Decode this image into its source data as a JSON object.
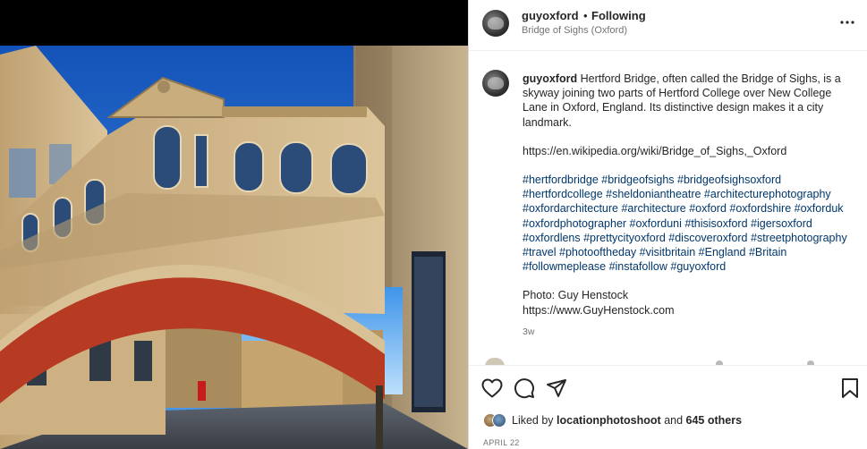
{
  "post": {
    "username": "guyoxford",
    "separator": "•",
    "follow_status": "Following",
    "location": "Bridge of Sighs (Oxford)",
    "image_icon": "bridge-photo"
  },
  "caption": {
    "username": "guyoxford",
    "text": "Hertford Bridge, often called the Bridge of Sighs, is a skyway joining two parts of Hertford College over New College Lane in Oxford, England. Its distinctive design makes it a city landmark.",
    "link": "https://en.wikipedia.org/wiki/Bridge_of_Sighs,_Oxford",
    "hashtags": "#hertfordbridge #bridgeofsighs #bridgeofsighsoxford #hertfordcollege #sheldoniantheatre #architecturephotography #oxfordarchitecture #architecture #oxford #oxfordshire #oxforduk #oxfordphotographer #oxforduni #thisisoxford #igersoxford #oxfordlens #prettycityoxford #discoveroxford #streetphotography #travel #photooftheday #visitbritain #England #Britain #followmeplease #instafollow #guyoxford",
    "credit": "Photo: Guy Henstock",
    "credit_link": "https://www.GuyHenstock.com",
    "age": "3w"
  },
  "actions": {
    "like_icon": "heart-icon",
    "comment_icon": "comment-icon",
    "share_icon": "share-icon",
    "save_icon": "bookmark-icon"
  },
  "likes": {
    "prefix": "Liked by",
    "user": "locationphotoshoot",
    "middle": "and",
    "others": "645 others"
  },
  "date": "APRIL 22",
  "colors": {
    "link": "#00376b",
    "muted": "#737373",
    "text": "#262626",
    "sky": "#1e6fd6",
    "stone": "#c9ad7d",
    "arch_red": "#b73a22"
  }
}
